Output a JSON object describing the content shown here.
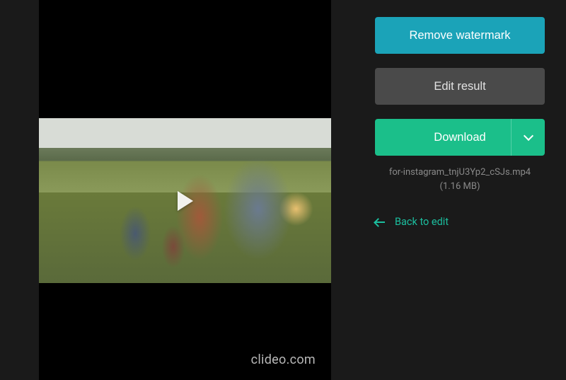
{
  "preview": {
    "watermark": "clideo.com"
  },
  "actions": {
    "remove_watermark_label": "Remove watermark",
    "edit_result_label": "Edit result",
    "download_label": "Download"
  },
  "file": {
    "name": "for-instagram_tnjU3Yp2_cSJs.mp4",
    "size": "(1.16 MB)"
  },
  "nav": {
    "back_label": "Back to edit"
  }
}
